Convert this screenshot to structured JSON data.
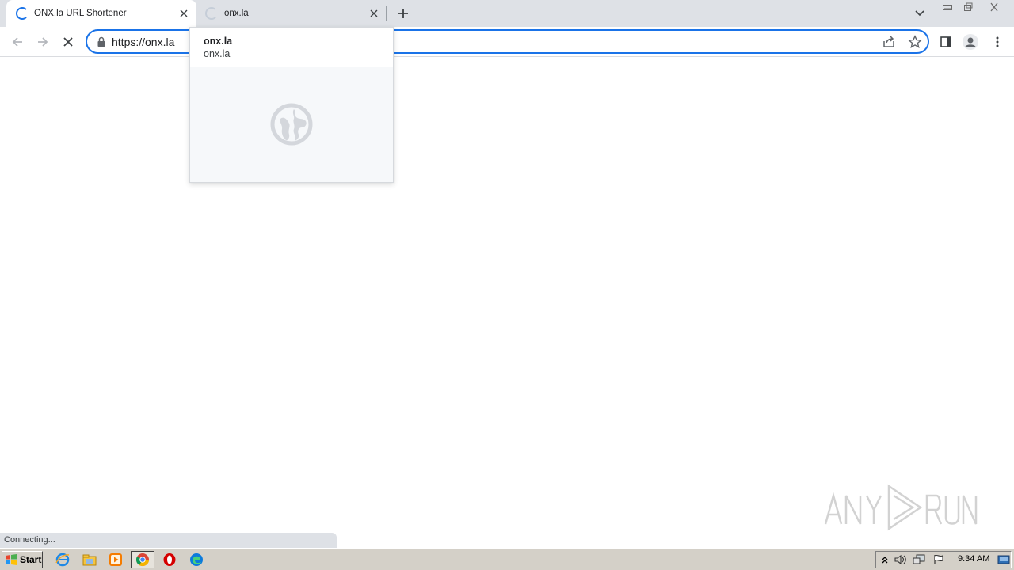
{
  "browser": {
    "tabs": [
      {
        "title": "ONX.la URL Shortener",
        "active": true,
        "loading": true
      },
      {
        "title": "onx.la",
        "active": false,
        "loading": true
      }
    ],
    "omnibox": {
      "url": "https://onx.la"
    },
    "accent_color": "#1a73e8"
  },
  "hover_card": {
    "title": "onx.la",
    "domain": "onx.la"
  },
  "status_bubble": {
    "text": "Connecting..."
  },
  "watermark": {
    "text": "ANY RUN"
  },
  "taskbar": {
    "start_label": "Start",
    "apps": [
      "ie-icon",
      "explorer-icon",
      "media-player-icon",
      "chrome-icon",
      "opera-icon",
      "edge-icon"
    ],
    "clock": "9:34 AM"
  }
}
